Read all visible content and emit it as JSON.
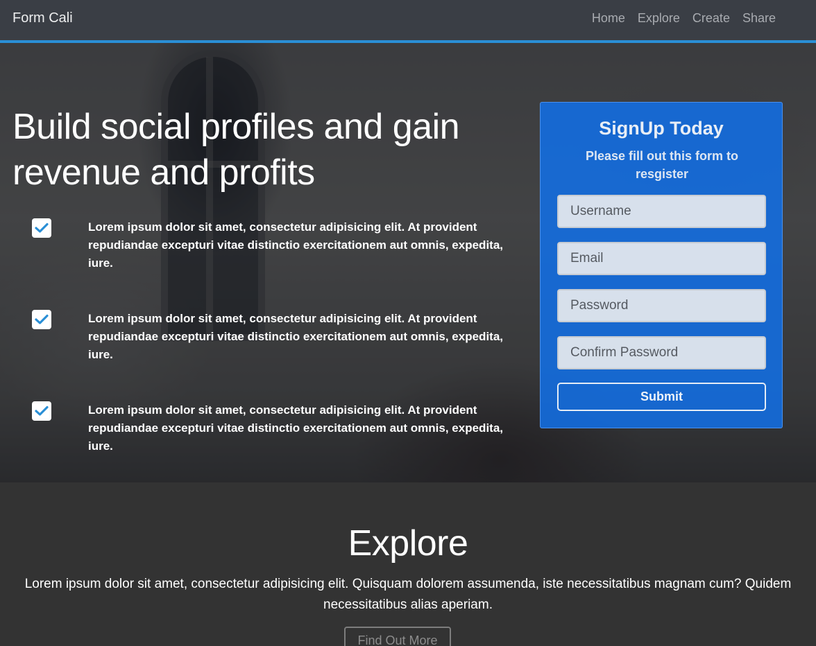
{
  "navbar": {
    "brand": "Form Cali",
    "links": [
      "Home",
      "Explore",
      "Create",
      "Share"
    ]
  },
  "hero": {
    "title_parts": [
      "Build ",
      "social profiles",
      " and gain revenue and ",
      "profits"
    ],
    "features": [
      {
        "checked": true,
        "text": "Lorem ipsum dolor sit amet, consectetur adipisicing elit. At provident repudiandae excepturi vitae distinctio exercitationem aut omnis, expedita, iure."
      },
      {
        "checked": true,
        "text": "Lorem ipsum dolor sit amet, consectetur adipisicing elit. At provident repudiandae excepturi vitae distinctio exercitationem aut omnis, expedita, iure."
      },
      {
        "checked": true,
        "text": "Lorem ipsum dolor sit amet, consectetur adipisicing elit. At provident repudiandae excepturi vitae distinctio exercitationem aut omnis, expedita, iure."
      }
    ]
  },
  "signup": {
    "title": "SignUp Today",
    "subtitle": "Please fill out this form to resgister",
    "fields": [
      {
        "placeholder": "Username",
        "value": ""
      },
      {
        "placeholder": "Email",
        "value": ""
      },
      {
        "placeholder": "Password",
        "value": ""
      },
      {
        "placeholder": "Confirm Password",
        "value": ""
      }
    ],
    "submit_label": "Submit"
  },
  "explore": {
    "title": "Explore",
    "text": "Lorem ipsum dolor sit amet, consectetur adipisicing elit. Quisquam dolorem assumenda, iste necessitatibus magnam cum? Quidem necessitatibus alias aperiam.",
    "button_label": "Find Out More"
  },
  "colors": {
    "accent": "#2a8fd6",
    "signup_bg": "#126ee4",
    "check": "#2a8fd6"
  },
  "icons": {
    "feature_check": "checkmark-icon"
  }
}
